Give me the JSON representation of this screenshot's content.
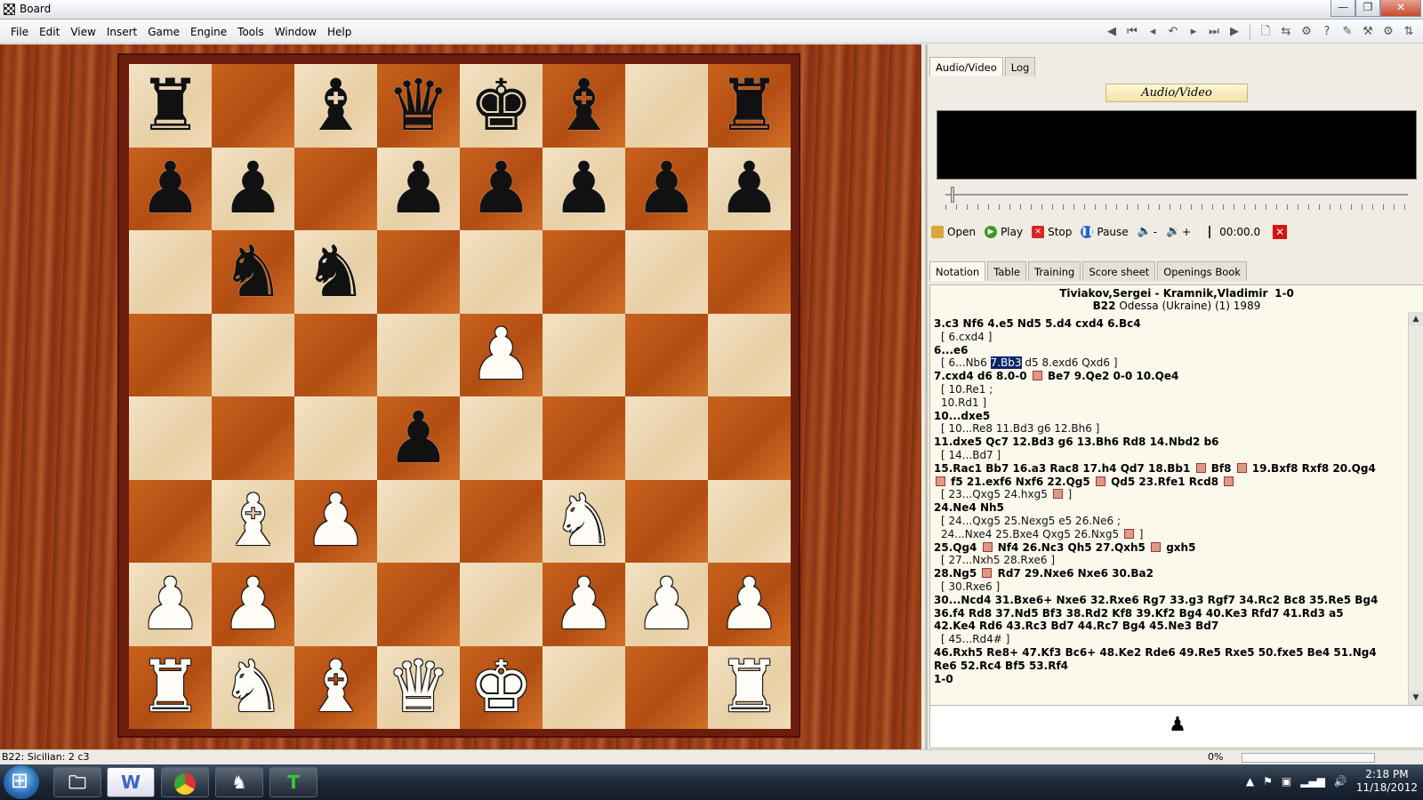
{
  "window": {
    "title": "Board",
    "minimize": "—",
    "restore": "❐",
    "close": "✕"
  },
  "menu": [
    "File",
    "Edit",
    "View",
    "Insert",
    "Game",
    "Engine",
    "Tools",
    "Window",
    "Help"
  ],
  "toolbar_icons": [
    "back-icon",
    "first-move-icon",
    "previous-move-icon",
    "undo-icon",
    "next-move-icon",
    "last-move-icon",
    "forward-icon",
    "new-game-icon",
    "replace-icon",
    "engine-icon",
    "analysis-icon",
    "training-icon",
    "tools-icon",
    "settings-icon",
    "flip-board-icon"
  ],
  "board": {
    "ranks": [
      [
        "r",
        "",
        "b",
        "q",
        "k",
        "b",
        "",
        "r"
      ],
      [
        "p",
        "p",
        "",
        "p",
        "p",
        "p",
        "p",
        "p"
      ],
      [
        "",
        "n",
        "n",
        "",
        "",
        "",
        "",
        ""
      ],
      [
        "",
        "",
        "",
        "",
        "P",
        "",
        "",
        ""
      ],
      [
        "",
        "",
        "",
        "p",
        "",
        "",
        "",
        ""
      ],
      [
        "",
        "B",
        "P",
        "",
        "",
        "N",
        "",
        ""
      ],
      [
        "P",
        "P",
        "",
        "",
        "",
        "P",
        "P",
        "P"
      ],
      [
        "R",
        "N",
        "B",
        "Q",
        "K",
        "",
        "",
        "R"
      ]
    ]
  },
  "panel": {
    "top_tabs": [
      "Audio/Video",
      "Log"
    ],
    "av_title": "Audio/Video",
    "media": {
      "open": "Open",
      "play": "Play",
      "stop": "Stop",
      "pause": "Pause",
      "vol_down": "-",
      "vol_up": "+",
      "time": "00:00.0"
    },
    "notation_tabs": [
      "Notation",
      "Table",
      "Training",
      "Score sheet",
      "Openings Book"
    ],
    "game": {
      "players": "Tiviakov,Sergei - Kramnik,Vladimir",
      "result": "1-0",
      "eco": "B22",
      "event": "Odessa (Ukraine) (1) 1989"
    },
    "moves": [
      {
        "t": "main",
        "parts": [
          {
            "x": "3.c3  Nf6  4.e5  Nd5  5.d4  cxd4  6.Bc4"
          }
        ]
      },
      {
        "t": "var",
        "parts": [
          {
            "x": "[ 6.cxd4 ]"
          }
        ]
      },
      {
        "t": "main",
        "parts": [
          {
            "x": "6...e6"
          }
        ]
      },
      {
        "t": "var",
        "parts": [
          {
            "x": "[ 6...Nb6 "
          },
          {
            "x": "7.Bb3",
            "hl": true
          },
          {
            "x": " d5  8.exd6  Qxd6 ]"
          }
        ]
      },
      {
        "t": "main",
        "parts": [
          {
            "x": "7.cxd4  d6  8.0-0 "
          },
          {
            "sym": true
          },
          {
            "x": " Be7  9.Qe2  0-0  10.Qe4"
          }
        ]
      },
      {
        "t": "var",
        "parts": [
          {
            "x": "[ 10.Re1 ;"
          }
        ]
      },
      {
        "t": "var",
        "parts": [
          {
            "x": "10.Rd1 ]"
          }
        ]
      },
      {
        "t": "main",
        "parts": [
          {
            "x": "10...dxe5"
          }
        ]
      },
      {
        "t": "var",
        "parts": [
          {
            "x": "[ 10...Re8  11.Bd3  g6  12.Bh6 ]"
          }
        ]
      },
      {
        "t": "main",
        "parts": [
          {
            "x": "11.dxe5  Qc7  12.Bd3  g6  13.Bh6  Rd8  14.Nbd2  b6"
          }
        ]
      },
      {
        "t": "var",
        "parts": [
          {
            "x": "[ 14...Bd7 ]"
          }
        ]
      },
      {
        "t": "main",
        "parts": [
          {
            "x": "15.Rac1  Bb7  16.a3  Rac8  17.h4  Qd7  18.Bb1 "
          },
          {
            "sym": true
          },
          {
            "x": " Bf8 "
          },
          {
            "sym": true
          },
          {
            "x": " 19.Bxf8  Rxf8  20.Qg4"
          }
        ]
      },
      {
        "t": "main",
        "parts": [
          {
            "sym": true
          },
          {
            "x": " f5  21.exf6  Nxf6  22.Qg5 "
          },
          {
            "sym": true
          },
          {
            "x": " Qd5  23.Rfe1  Rcd8 "
          },
          {
            "sym": true
          }
        ]
      },
      {
        "t": "var",
        "parts": [
          {
            "x": "[ 23...Qxg5  24.hxg5 "
          },
          {
            "sym": true
          },
          {
            "x": " ]"
          }
        ]
      },
      {
        "t": "main",
        "parts": [
          {
            "x": "24.Ne4  Nh5"
          }
        ]
      },
      {
        "t": "var",
        "parts": [
          {
            "x": "[ 24...Qxg5  25.Nexg5  e5  26.Ne6 ;"
          }
        ]
      },
      {
        "t": "var",
        "parts": [
          {
            "x": "24...Nxe4  25.Bxe4  Qxg5  26.Nxg5 "
          },
          {
            "sym": true
          },
          {
            "x": " ]"
          }
        ]
      },
      {
        "t": "main",
        "parts": [
          {
            "x": "25.Qg4 "
          },
          {
            "sym": true
          },
          {
            "x": " Nf4  26.Nc3  Qh5  27.Qxh5 "
          },
          {
            "sym": true
          },
          {
            "x": " gxh5"
          }
        ]
      },
      {
        "t": "var",
        "parts": [
          {
            "x": "[ 27...Nxh5  28.Rxe6 ]"
          }
        ]
      },
      {
        "t": "main",
        "parts": [
          {
            "x": "28.Ng5 "
          },
          {
            "sym": true
          },
          {
            "x": " Rd7  29.Nxe6  Nxe6  30.Ba2"
          }
        ]
      },
      {
        "t": "var",
        "parts": [
          {
            "x": "[ 30.Rxe6 ]"
          }
        ]
      },
      {
        "t": "main",
        "parts": [
          {
            "x": "30...Ncd4  31.Bxe6+  Nxe6  32.Rxe6  Rg7  33.g3  Rgf7  34.Rc2  Bc8  35.Re5  Bg4"
          }
        ]
      },
      {
        "t": "main",
        "parts": [
          {
            "x": "36.f4  Rd8  37.Nd5  Bf3  38.Rd2  Kf8  39.Kf2  Bg4  40.Ke3  Rfd7  41.Rd3  a5"
          }
        ]
      },
      {
        "t": "main",
        "parts": [
          {
            "x": "42.Ke4  Rd6  43.Rc3  Bd7  44.Rc7  Bg4  45.Ne3  Bd7"
          }
        ]
      },
      {
        "t": "var",
        "parts": [
          {
            "x": "[ 45...Rd4# ]"
          }
        ]
      },
      {
        "t": "main",
        "parts": [
          {
            "x": "46.Rxh5  Re8+  47.Kf3  Bc6+  48.Ke2  Rde6  49.Re5  Rxe5  50.fxe5  Be4  51.Ng4"
          }
        ]
      },
      {
        "t": "main",
        "parts": [
          {
            "x": "Re6  52.Rc4  Bf5  53.Rf4"
          }
        ]
      },
      {
        "t": "main",
        "parts": [
          {
            "x": "1-0"
          }
        ]
      }
    ],
    "side_to_move_icon": "black-pawn-icon"
  },
  "status": {
    "text": "B22: Sicilian: 2 c3",
    "progress": "0%",
    "progress_value": 0
  },
  "taskbar": {
    "apps": [
      "file-explorer-icon",
      "word-icon",
      "chrome-icon",
      "chess-app-icon",
      "t-app-icon"
    ],
    "clock_time": "2:18 PM",
    "clock_date": "11/18/2012"
  }
}
